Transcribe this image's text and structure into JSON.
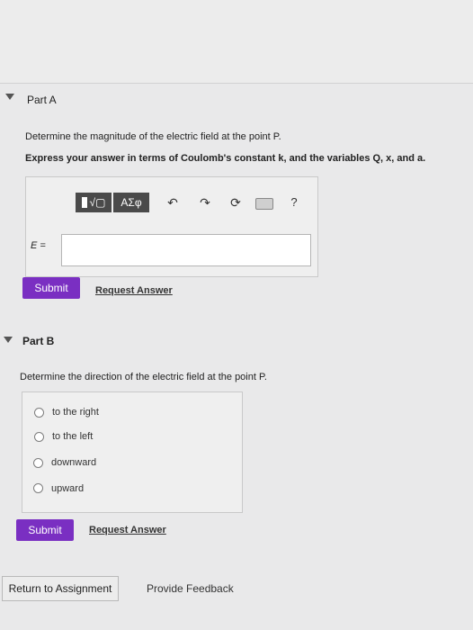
{
  "part_a": {
    "title": "Part A",
    "question": "Determine the magnitude of the electric field at the point P.",
    "instruction": "Express your answer in terms of Coulomb's constant k, and the variables Q, x, and a.",
    "toolbar": {
      "templates_icon": "templates-icon",
      "greek_label": "ΑΣφ",
      "undo_icon": "undo-icon",
      "redo_icon": "redo-icon",
      "reset_icon": "reset-icon",
      "keyboard_icon": "keyboard-icon",
      "help_label": "?"
    },
    "answer_label": "E =",
    "answer_value": "",
    "submit_label": "Submit",
    "request_answer_label": "Request Answer"
  },
  "part_b": {
    "title": "Part B",
    "question": "Determine the direction of the electric field at the point P.",
    "options": [
      "to the right",
      "to the left",
      "downward",
      "upward"
    ],
    "submit_label": "Submit",
    "request_answer_label": "Request Answer"
  },
  "footer": {
    "return_label": "Return to Assignment",
    "feedback_label": "Provide Feedback"
  },
  "colors": {
    "accent": "#7a2fc2",
    "background": "#e9e9ea"
  }
}
